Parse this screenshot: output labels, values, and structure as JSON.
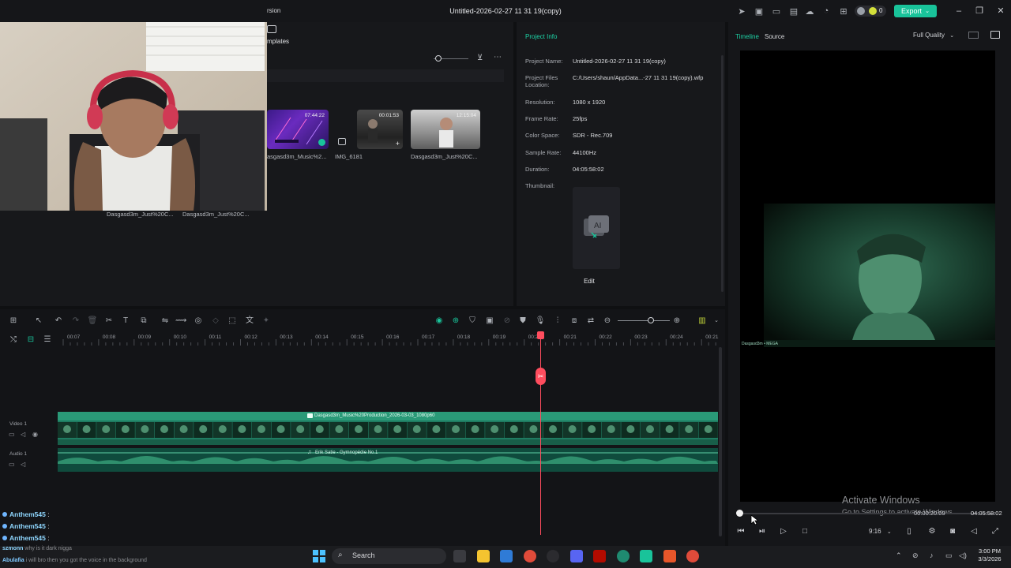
{
  "app": {
    "title": "Untitled-2026-02-27 11 31 19(copy)",
    "version_fragment": "rsion",
    "export_label": "Export",
    "credits": "0",
    "brand_color": "#19c39a"
  },
  "media": {
    "templates_label": "mplates",
    "items": [
      {
        "time": "07:44:22",
        "label": "asgasd3m_Music%2..."
      },
      {
        "time": "00:01:53",
        "label": "IMG_6181"
      },
      {
        "time": "12:15:04",
        "label": "Dasgasd3m_Just%20C..."
      }
    ],
    "bottom_labels": [
      "Dasgasd3m_Just%20C...",
      "Dasgasd3m_Just%20C..."
    ]
  },
  "project_info": {
    "tab": "Project Info",
    "rows": [
      {
        "label": "Project Name:",
        "value": "Untitled-2026-02-27 11 31 19(copy)"
      },
      {
        "label": "Project Files Location:",
        "value": "C:/Users/shaun/AppData...-27 11 31 19(copy).wfp"
      },
      {
        "label": "Resolution:",
        "value": "1080 x 1920"
      },
      {
        "label": "Frame Rate:",
        "value": "25fps"
      },
      {
        "label": "Color Space:",
        "value": "SDR - Rec.709"
      },
      {
        "label": "Sample Rate:",
        "value": "44100Hz"
      },
      {
        "label": "Duration:",
        "value": "04:05:58:02"
      },
      {
        "label": "Thumbnail:",
        "value": ""
      }
    ],
    "edit_label": "Edit"
  },
  "preview": {
    "tab_timeline": "Timeline",
    "tab_source": "Source",
    "quality": "Full Quality",
    "current_time": "00:00:20:09",
    "total_time": "04:05:58:02",
    "ratio": "9:16",
    "watermark_line1": "Activate Windows",
    "watermark_line2": "Go to Settings to activate Windows.",
    "clip_caption": "Dasgasd3m • MEGA",
    "scrub_position": 0.0
  },
  "timeline": {
    "ruler": [
      "00:07",
      "00:08",
      "00:09",
      "00:10",
      "00:11",
      "00:12",
      "00:13",
      "00:14",
      "00:15",
      "00:16",
      "00:17",
      "00:18",
      "00:19",
      "00:20",
      "00:21",
      "00:22",
      "00:23",
      "00:24",
      "00:21"
    ],
    "video_track_label": "Video 1",
    "audio_track_label": "Audio 1",
    "video_clip": "Dasgasd3m_Music%20Production_2026-03-03_1080p60",
    "audio_clip": "Erik Satie - Gymnopédie No.1",
    "playhead_color": "#ff4d5e"
  },
  "chat": [
    {
      "user": "Anthem545",
      "text": ":"
    },
    {
      "user": "Anthem545",
      "text": ":"
    },
    {
      "user": "Anthem545",
      "text": ":"
    },
    {
      "user": "szmonn",
      "text": "why is it dark nigga"
    },
    {
      "user": "Abulafia",
      "text": "i will bro then you got the voice in the background"
    }
  ],
  "taskbar": {
    "search": "Search",
    "time": "3:00 PM",
    "date": "3/3/2026"
  }
}
